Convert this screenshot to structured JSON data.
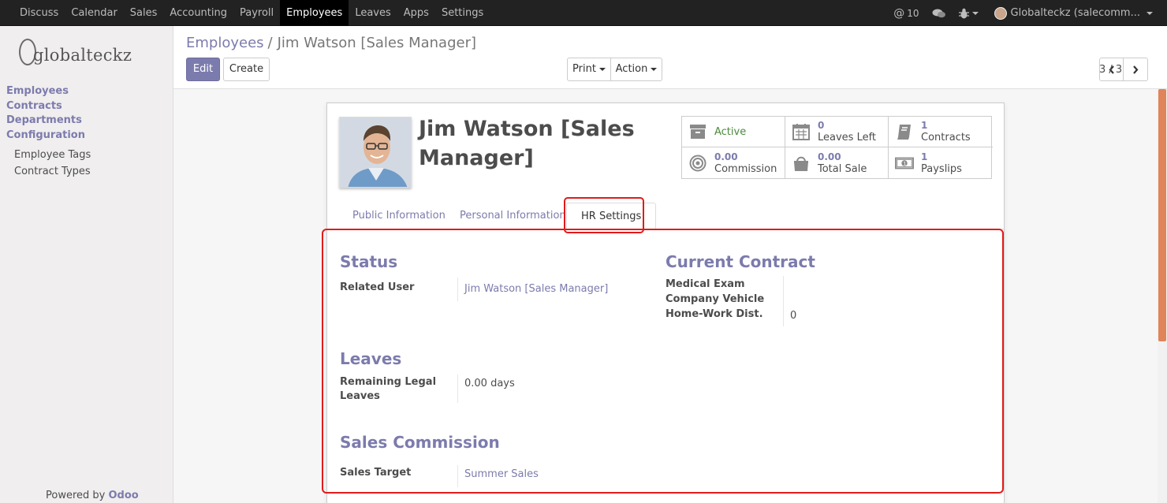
{
  "navbar": {
    "menu": [
      "Discuss",
      "Calendar",
      "Sales",
      "Accounting",
      "Payroll",
      "Employees",
      "Leaves",
      "Apps",
      "Settings"
    ],
    "active_menu": "Employees",
    "messages_count": "10",
    "user": "Globalteckz (salecomm..."
  },
  "sidebar": {
    "logo_text": "globalteckz",
    "headers": [
      "Employees",
      "Contracts",
      "Departments",
      "Configuration"
    ],
    "subitems": [
      "Employee Tags",
      "Contract Types"
    ],
    "powered_prefix": "Powered by",
    "powered_brand": "Odoo"
  },
  "control": {
    "breadcrumb_parent": "Employees",
    "breadcrumb_sep": "/",
    "breadcrumb_current": "Jim Watson [Sales Manager]",
    "edit": "Edit",
    "create": "Create",
    "print": "Print",
    "action": "Action",
    "pager": "3 / 3"
  },
  "employee": {
    "name": "Jim Watson [Sales Manager]",
    "stats": {
      "active": "Active",
      "leaves_value": "0",
      "leaves_label": "Leaves Left",
      "contracts_value": "1",
      "contracts_label": "Contracts",
      "commission_value": "0.00",
      "commission_label": "Commission",
      "sale_value": "0.00",
      "sale_label": "Total Sale",
      "payslips_value": "1",
      "payslips_label": "Payslips"
    }
  },
  "tabs": [
    "Public Information",
    "Personal Information",
    "HR Settings"
  ],
  "hr": {
    "status_title": "Status",
    "related_user_label": "Related User",
    "related_user_value": "Jim Watson [Sales Manager]",
    "contract_title": "Current Contract",
    "medical_exam_label": "Medical Exam",
    "company_vehicle_label": "Company Vehicle",
    "home_work_label": "Home-Work Dist.",
    "home_work_value": "0",
    "leaves_title": "Leaves",
    "remaining_leaves_label_1": "Remaining Legal",
    "remaining_leaves_label_2": "Leaves",
    "remaining_leaves_value": "0.00 days",
    "commission_title": "Sales Commission",
    "sales_target_label": "Sales Target",
    "sales_target_value": "Summer Sales"
  },
  "colors": {
    "brand": "#7c7bad",
    "highlight": "#e01b1b",
    "active_status": "#4a8a3c"
  }
}
